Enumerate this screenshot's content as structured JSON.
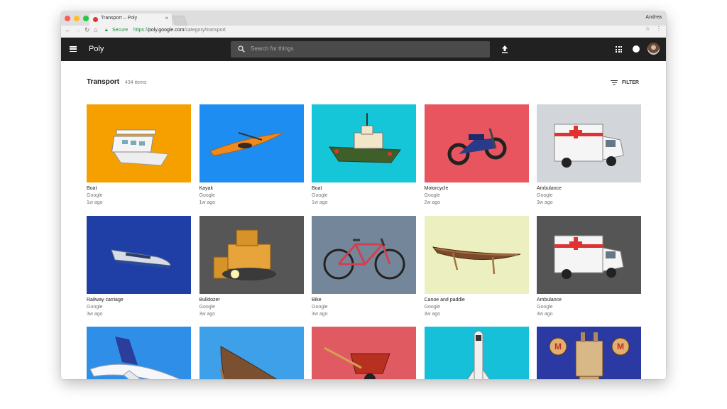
{
  "browser": {
    "tab_title": "Transport – Poly",
    "tab_close": "×",
    "user_name": "Andrea",
    "secure_label": "Secure",
    "url_scheme": "https://",
    "url_host": "poly.google.com",
    "url_path": "/category/transport"
  },
  "appbar": {
    "logo": "Poly",
    "search_placeholder": "Search for things"
  },
  "page": {
    "heading": "Transport",
    "count": "434 items",
    "filter_label": "FILTER"
  },
  "items": [
    {
      "title": "Boat",
      "author": "Google",
      "time": "1w ago",
      "bg": "#f6a000",
      "icon": "houseboat-model"
    },
    {
      "title": "Kayak",
      "author": "Google",
      "time": "1w ago",
      "bg": "#1e8df2",
      "icon": "kayak-model"
    },
    {
      "title": "Boat",
      "author": "Google",
      "time": "1w ago",
      "bg": "#14c6d8",
      "icon": "tugboat-model"
    },
    {
      "title": "Motorcycle",
      "author": "Google",
      "time": "2w ago",
      "bg": "#e8555f",
      "icon": "motorcycle-model"
    },
    {
      "title": "Ambulance",
      "author": "Google",
      "time": "3w ago",
      "bg": "#d2d6da",
      "icon": "ambulance-model"
    },
    {
      "title": "Railway carriage",
      "author": "Google",
      "time": "3w ago",
      "bg": "#1f3fa6",
      "icon": "train-model"
    },
    {
      "title": "Bulldozer",
      "author": "Google",
      "time": "3w ago",
      "bg": "#565656",
      "icon": "bulldozer-model"
    },
    {
      "title": "Bike",
      "author": "Google",
      "time": "3w ago",
      "bg": "#74879a",
      "icon": "bike-model"
    },
    {
      "title": "Canoe and paddle",
      "author": "Google",
      "time": "3w ago",
      "bg": "#ecf0c0",
      "icon": "canoe-model"
    },
    {
      "title": "Ambulance",
      "author": "Google",
      "time": "3w ago",
      "bg": "#555555",
      "icon": "ambulance-model"
    },
    {
      "title": "",
      "author": "",
      "time": "",
      "bg": "#2f8ee8",
      "icon": "airplane-model"
    },
    {
      "title": "",
      "author": "",
      "time": "",
      "bg": "#3fa0ea",
      "icon": "rowboat-model"
    },
    {
      "title": "",
      "author": "",
      "time": "",
      "bg": "#e05a62",
      "icon": "wheelbarrow-model"
    },
    {
      "title": "",
      "author": "",
      "time": "",
      "bg": "#15c0d8",
      "icon": "space-shuttle-model"
    },
    {
      "title": "",
      "author": "",
      "time": "",
      "bg": "#2a3aa2",
      "icon": "robot-model"
    }
  ]
}
